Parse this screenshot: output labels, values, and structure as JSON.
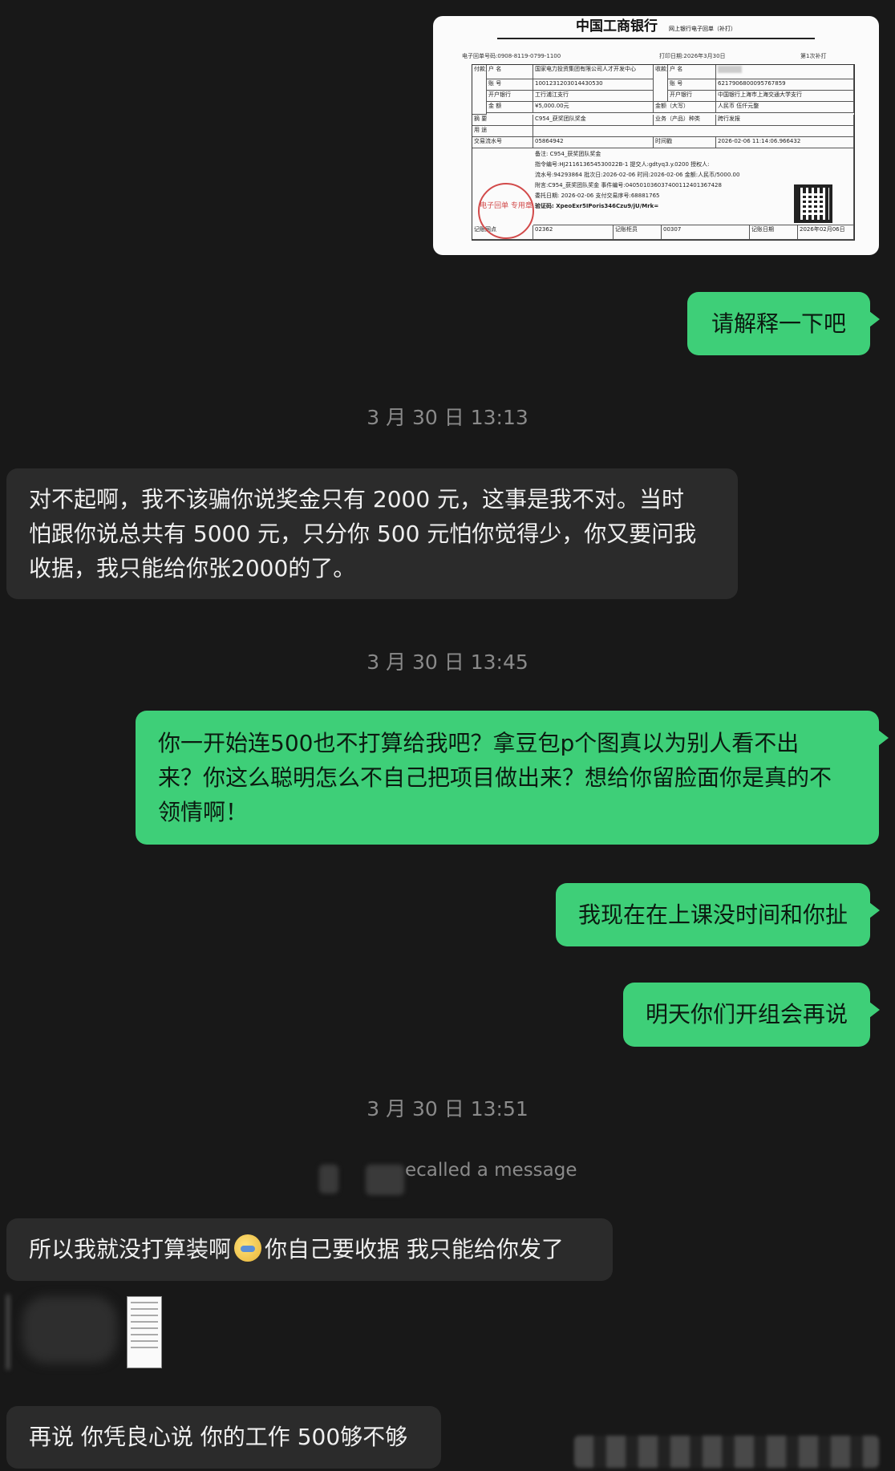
{
  "receipt": {
    "title": "中国工商银行",
    "subtitle": "网上银行电子回单（补打）",
    "receipt_no_label": "电子回单号码:",
    "receipt_no": "0908-8119-0799-1100",
    "print_date_label": "打印日期:",
    "print_date": "2026年3月30日",
    "print_count": "第1次补打",
    "payer_name_label": "户 名",
    "payer_name": "国家电力投资集团有限公司人才开发中心",
    "payer_account_label": "账 号",
    "payer_account": "1001231203014430530",
    "payer_bank_label": "开户银行",
    "payer_bank": "工行浦江支行",
    "payee_name_label": "户 名",
    "payee_account_label": "账 号",
    "payee_account": "6217906800095767859",
    "payee_bank_label": "开户银行",
    "payee_bank": "中国银行上海市上海交通大学支行",
    "amount_label": "金 额",
    "amount": "¥5,000.00元",
    "amount_upper_label": "金额（大写）",
    "amount_upper": "人民币 伍仟元整",
    "summary_label": "摘 要",
    "summary": "C954_获奖团队奖金",
    "business_label": "业务（产品）种类",
    "business": "跨行发报",
    "purpose_label": "用 途",
    "serial_label": "交易流水号",
    "serial": "05864942",
    "time_label": "时间戳",
    "time": "2026-02-06 11:14:06.966432",
    "remark_1": "备注: C954_获奖团队奖金",
    "remark_2": "指令编号:HJ211613654530022B-1 提交人:gdtyq3.y.0200 授权人:",
    "remark_3": "流水号:94293864 批次日:2026-02-06 时间:2026-02-06 金额:人民币/5000.00",
    "remark_4": "附言:C954_获奖团队奖金 事件编号:040501036037400112401367428",
    "remark_5": "委托日期: 2026-02-06 支付交易序号:68881765",
    "remark_6": "验证码: XpeoExr5IPoris346Czu9/jU/Mrk=",
    "stamp_text": "电子回单 专用章",
    "record_site_label": "记账网点",
    "record_site": "02362",
    "teller_label": "记账柜员",
    "teller": "00307",
    "record_date_label": "记账日期",
    "record_date": "2026年02月06日"
  },
  "messages": {
    "m1": "请解释一下吧",
    "t1": "3 月 30 日 13:13",
    "m2_lines": [
      "对不起啊，我不该骗你说奖金只有 2000 元，这事是我不对。当时",
      "怕跟你说总共有 5000 元，只分你 500 元怕你觉得少，你又要问我",
      "收据，我只能给你张2000的了。"
    ],
    "t2": "3 月 30 日 13:45",
    "m3_lines": [
      "你一开始连500也不打算给我吧？拿豆包p个图真以为别人看不出",
      "来？你这么聪明怎么不自己把项目做出来？想给你留脸面你是真的不",
      "领情啊！"
    ],
    "m4": "我现在在上课没时间和你扯",
    "m5": "明天你们开组会再说",
    "t3": "3 月 30 日 13:51",
    "recalled": "ecalled a message",
    "m6_a": "所以我就没打算装啊",
    "m6_b": "你自己要收据 我只能给你发了",
    "m7": "再说 你凭良心说 你的工作 500够不够"
  }
}
